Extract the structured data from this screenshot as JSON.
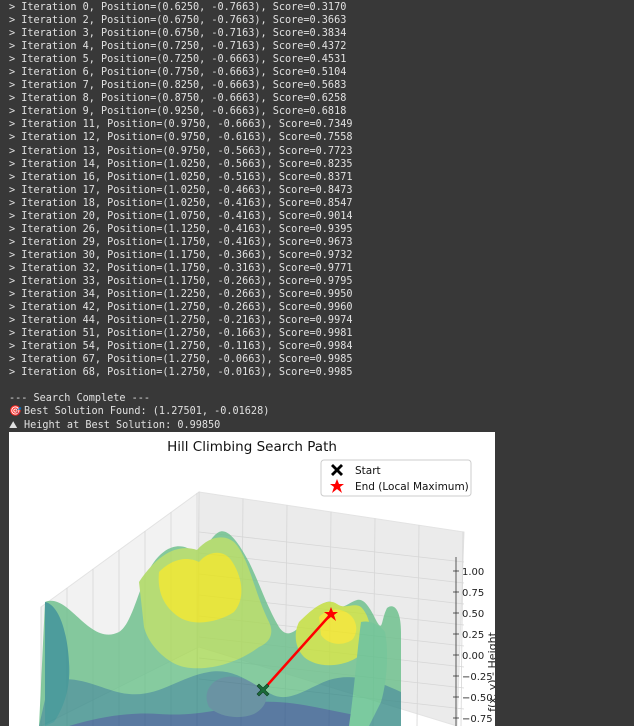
{
  "console": {
    "lines": [
      "> Iteration 0, Position=(0.6250, -0.7663), Score=0.3170",
      "> Iteration 2, Position=(0.6750, -0.7663), Score=0.3663",
      "> Iteration 3, Position=(0.6750, -0.7163), Score=0.3834",
      "> Iteration 4, Position=(0.7250, -0.7163), Score=0.4372",
      "> Iteration 5, Position=(0.7250, -0.6663), Score=0.4531",
      "> Iteration 6, Position=(0.7750, -0.6663), Score=0.5104",
      "> Iteration 7, Position=(0.8250, -0.6663), Score=0.5683",
      "> Iteration 8, Position=(0.8750, -0.6663), Score=0.6258",
      "> Iteration 9, Position=(0.9250, -0.6663), Score=0.6818",
      "> Iteration 11, Position=(0.9750, -0.6663), Score=0.7349",
      "> Iteration 12, Position=(0.9750, -0.6163), Score=0.7558",
      "> Iteration 13, Position=(0.9750, -0.5663), Score=0.7723",
      "> Iteration 14, Position=(1.0250, -0.5663), Score=0.8235",
      "> Iteration 16, Position=(1.0250, -0.5163), Score=0.8371",
      "> Iteration 17, Position=(1.0250, -0.4663), Score=0.8473",
      "> Iteration 18, Position=(1.0250, -0.4163), Score=0.8547",
      "> Iteration 20, Position=(1.0750, -0.4163), Score=0.9014",
      "> Iteration 26, Position=(1.1250, -0.4163), Score=0.9395",
      "> Iteration 29, Position=(1.1750, -0.4163), Score=0.9673",
      "> Iteration 30, Position=(1.1750, -0.3663), Score=0.9732",
      "> Iteration 32, Position=(1.1750, -0.3163), Score=0.9771",
      "> Iteration 33, Position=(1.1750, -0.2663), Score=0.9795",
      "> Iteration 34, Position=(1.2250, -0.2663), Score=0.9950",
      "> Iteration 42, Position=(1.2750, -0.2663), Score=0.9960",
      "> Iteration 44, Position=(1.2750, -0.2163), Score=0.9974",
      "> Iteration 51, Position=(1.2750, -0.1663), Score=0.9981",
      "> Iteration 54, Position=(1.2750, -0.1163), Score=0.9984",
      "> Iteration 67, Position=(1.2750, -0.0663), Score=0.9985",
      "> Iteration 68, Position=(1.2750, -0.0163), Score=0.9985"
    ],
    "complete": "--- Search Complete ---",
    "best_emoji": "🎯",
    "best": "Best Solution Found: (1.27501, -0.01628)",
    "height_emoji": "⛰",
    "height": "Height at Best Solution: 0.99850"
  },
  "chart_data": {
    "type": "surface3d",
    "title": "Hill Climbing Search Path",
    "zlabel": "f(x, y) - Height",
    "zticks": [
      "1.00",
      "0.75",
      "0.50",
      "0.25",
      "0.00",
      "−0.25",
      "−0.50",
      "−0.75"
    ],
    "legend": {
      "placement": "top-right",
      "entries": [
        {
          "label": "Start",
          "marker": "X",
          "color": "#000000"
        },
        {
          "label": "End (Local Maximum)",
          "marker": "star",
          "color": "#ff0000"
        }
      ]
    },
    "path_line_color": "#ff0000",
    "start_point": {
      "x": 0.625,
      "y": -0.7663,
      "z": 0.317
    },
    "end_point": {
      "x": 1.275,
      "y": -0.0163,
      "z": 0.9985
    },
    "colormap": "viridis",
    "grid": true
  }
}
